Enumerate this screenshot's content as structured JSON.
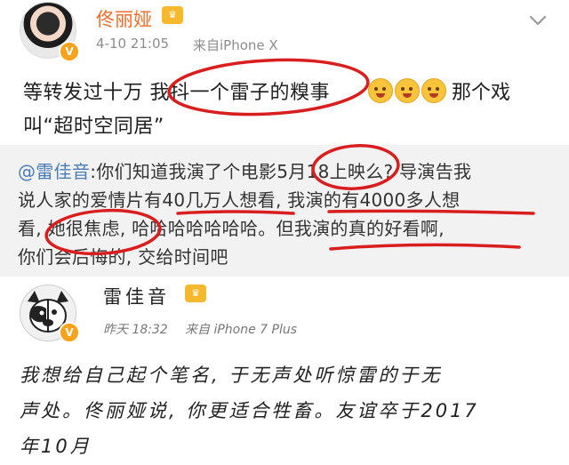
{
  "post": {
    "author": "佟丽娅",
    "time": "4-10 21:05",
    "source": "来自iPhone X",
    "text_line1": "等转发过十万 我抖一个雷子的糗事",
    "text_after_emoji": "那个戏",
    "text_line2": "叫“超时空同居”"
  },
  "quoted": {
    "mention": "@雷佳音",
    "line1_rest": ":你们知道我演了个电影5月18上映么? 导演告我",
    "line2": "说人家的爱情片有40几万人想看, 我演的有4000多人想",
    "line3": "看, 她很焦虑, 哈哈哈哈哈哈哈。但我演的真的好看啊,",
    "line4": "你们会后悔的, 交给时间吧"
  },
  "reply": {
    "author": "雷佳音",
    "time": "昨天 18:32",
    "source": "来自 iPhone 7 Plus",
    "line1": "我想给自己起个笔名, 于无声处听惊雷的于无",
    "line2": "声处。佟丽娅说, 你更适合牲畜。友谊卒于2017",
    "line3": "年10月"
  },
  "icons": {
    "chevron": "chevron-down-icon",
    "verified": "verified-badge-icon",
    "crown": "crown-badge-icon",
    "emoji": "emoji-icon"
  },
  "colors": {
    "name_orange": "#f26d2a",
    "mention_blue": "#4a7bb7",
    "annotation_red": "#d81e1e",
    "quote_bg": "#f2f2f2"
  }
}
